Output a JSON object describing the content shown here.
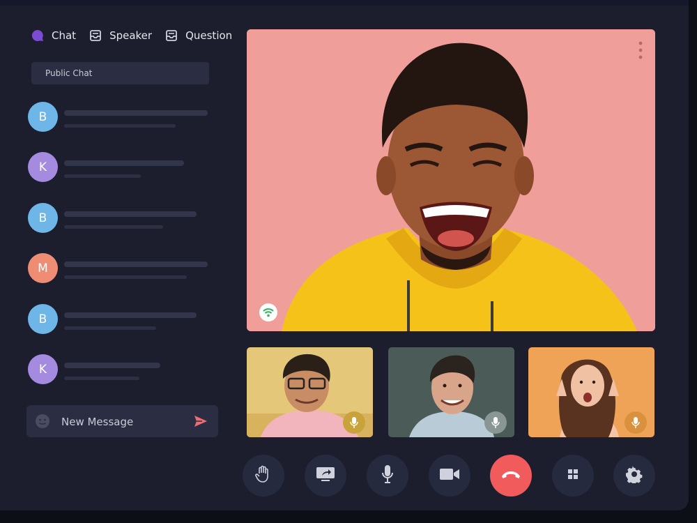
{
  "tabs": [
    {
      "label": "Chat",
      "icon": "chat-bubble-icon"
    },
    {
      "label": "Speaker",
      "icon": "inbox-icon"
    },
    {
      "label": "Question",
      "icon": "inbox-icon"
    }
  ],
  "public_chat": {
    "label": "Public Chat"
  },
  "messages": [
    {
      "initial": "B",
      "avatar_color": "#6fb6e8"
    },
    {
      "initial": "K",
      "avatar_color": "#a58be0"
    },
    {
      "initial": "B",
      "avatar_color": "#6fb6e8"
    },
    {
      "initial": "M",
      "avatar_color": "#ee8d74"
    },
    {
      "initial": "B",
      "avatar_color": "#6fb6e8"
    },
    {
      "initial": "K",
      "avatar_color": "#a58be0"
    }
  ],
  "composer": {
    "placeholder": "New Message",
    "emoji_icon": "emoji-icon",
    "send_icon": "send-icon"
  },
  "main_video": {
    "background": "#ef9e9a",
    "status_icon": "wifi-icon",
    "menu_icon": "more-vertical-icon"
  },
  "thumbnails": [
    {
      "background": "#e5c77a",
      "mic_color": "#c8a23a"
    },
    {
      "background": "#4b5c58",
      "mic_color": "#8a9693"
    },
    {
      "background": "#eea357",
      "mic_color": "#d9913e"
    }
  ],
  "controls": [
    {
      "name": "raise-hand",
      "icon": "hand-icon"
    },
    {
      "name": "share-screen",
      "icon": "screen-share-icon"
    },
    {
      "name": "microphone",
      "icon": "microphone-icon"
    },
    {
      "name": "camera",
      "icon": "video-camera-icon"
    },
    {
      "name": "end-call",
      "icon": "phone-hangup-icon",
      "color": "#f15b5b"
    },
    {
      "name": "layout",
      "icon": "grid-icon"
    },
    {
      "name": "settings",
      "icon": "gear-icon"
    }
  ],
  "colors": {
    "background": "#1c1e2e",
    "panel": "#2b2e42",
    "accent": "#7b4bd1",
    "send": "#f06d74"
  }
}
